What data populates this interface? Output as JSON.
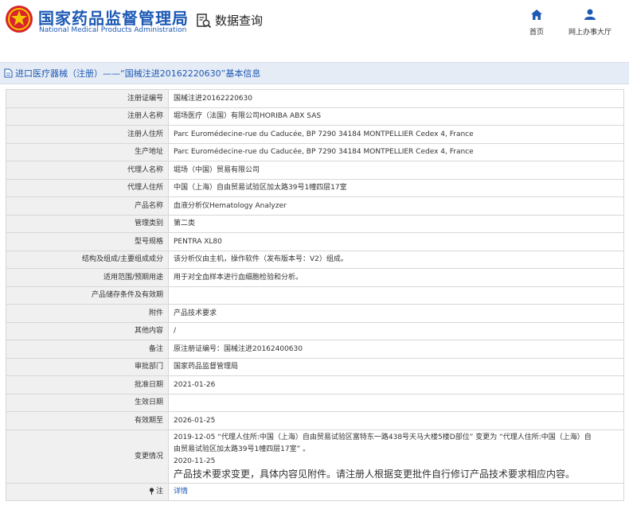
{
  "header": {
    "site_name_cn": "国家药品监督管理局",
    "site_name_en": "National Medical Products Administration",
    "query_label": "数据查询",
    "nav_home": "首页",
    "nav_service": "网上办事大厅"
  },
  "colors": {
    "brand": "#1d59b4",
    "title_bar": "#e6ecf5",
    "label_bg": "#f0f0f0"
  },
  "icons": {
    "logo": "emblem-icon",
    "query": "search-document-icon",
    "home": "home-icon",
    "service": "user-icon",
    "title": "document-icon"
  },
  "title_bar": "进口医疗器械（注册）——“国械注进20162220630”基本信息",
  "rows": [
    {
      "label": "注册证编号",
      "value": "国械注进20162220630"
    },
    {
      "label": "注册人名称",
      "value": "堀场医疗（法国）有限公司HORIBA ABX SAS"
    },
    {
      "label": "注册人住所",
      "value": "Parc Euromédecine-rue du Caducée, BP 7290 34184 MONTPELLIER Cedex 4, France"
    },
    {
      "label": "生产地址",
      "value": "Parc Euromédecine-rue du Caducée, BP 7290 34184 MONTPELLIER Cedex 4, France"
    },
    {
      "label": "代理人名称",
      "value": "堀场（中国）贸易有限公司"
    },
    {
      "label": "代理人住所",
      "value": "中国（上海）自由贸易试验区加太路39号1幢四层17室"
    },
    {
      "label": "产品名称",
      "value": "血液分析仪Hematology Analyzer"
    },
    {
      "label": "管理类别",
      "value": "第二类"
    },
    {
      "label": "型号规格",
      "value": "PENTRA XL80"
    },
    {
      "label": "结构及组成/主要组成成分",
      "value": "该分析仪由主机，操作软件（发布版本号：V2）组成。"
    },
    {
      "label": "适用范围/预期用途",
      "value": "用于对全血样本进行血细胞检验和分析。"
    },
    {
      "label": "产品储存条件及有效期",
      "value": ""
    },
    {
      "label": "附件",
      "value": "产品技术要求"
    },
    {
      "label": "其他内容",
      "value": "/"
    },
    {
      "label": "备注",
      "value": "原注册证编号：国械注进20162400630"
    },
    {
      "label": "审批部门",
      "value": "国家药品监督管理局"
    },
    {
      "label": "批准日期",
      "value": "2021-01-26"
    },
    {
      "label": "生效日期",
      "value": ""
    },
    {
      "label": "有效期至",
      "value": "2026-01-25"
    }
  ],
  "change_row": {
    "label": "变更情况",
    "line1": "2019-12-05 “代理人住所:中国（上海）自由贸易试验区富特东一路438号天马大楼5楼D部位” 变更为 “代理人住所:中国（上海）自",
    "line2": "由贸易试验区加太路39号1幢四层17室” 。",
    "line3": "2020-11-25",
    "line4": "产品技术要求变更，具体内容见附件。请注册人根据变更批件自行修订产品技术要求相应内容。"
  },
  "note_row": {
    "label": "注",
    "link": "详情"
  }
}
